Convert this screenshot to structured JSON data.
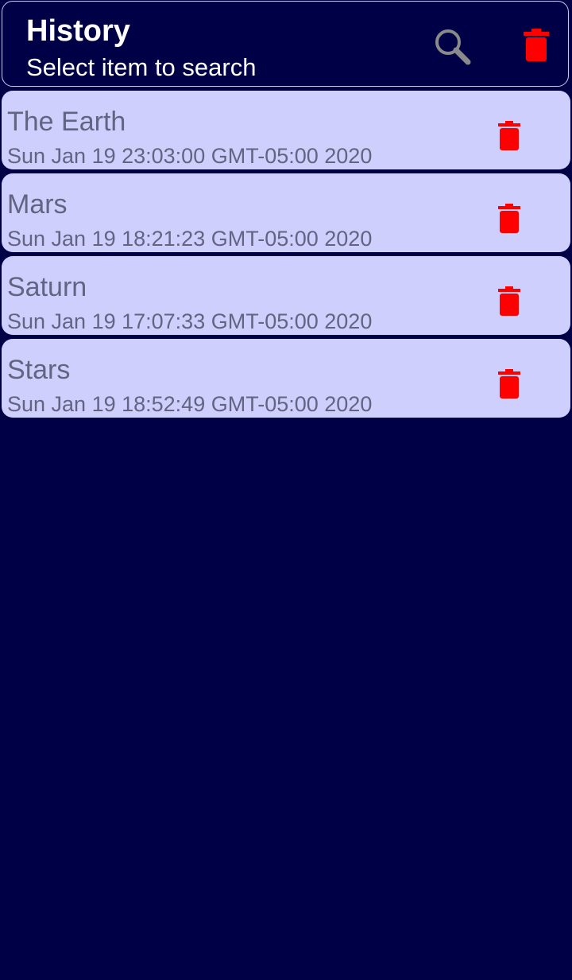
{
  "header": {
    "title": "History",
    "subtitle": "Select item to search",
    "search_icon": "search-icon",
    "delete_all_icon": "trash-icon"
  },
  "colors": {
    "background": "#000046",
    "item_background": "#cfcffd",
    "item_text": "#636382",
    "delete_red": "#ff0000"
  },
  "items": [
    {
      "title": "The Earth",
      "date": "Sun Jan 19 23:03:00 GMT-05:00 2020"
    },
    {
      "title": "Mars",
      "date": "Sun Jan 19 18:21:23 GMT-05:00 2020"
    },
    {
      "title": "Saturn",
      "date": "Sun Jan 19 17:07:33 GMT-05:00 2020"
    },
    {
      "title": "Stars",
      "date": "Sun Jan 19 18:52:49 GMT-05:00 2020"
    }
  ]
}
